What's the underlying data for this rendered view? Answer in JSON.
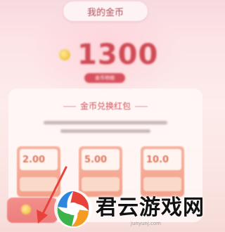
{
  "header": {
    "title": "我的金币"
  },
  "balance": {
    "amount": "1300",
    "detail_label": "金币明细"
  },
  "exchange": {
    "title": "金币兑换红包",
    "rewards": [
      {
        "amount": "2.00"
      },
      {
        "amount": "5.00"
      },
      {
        "amount": "10.0"
      }
    ]
  },
  "watermark": {
    "brand": "君云游戏网",
    "url": "junyunj.com"
  },
  "colors": {
    "accent": "#cf4b55",
    "coin": "#f2c94c",
    "reward_card": "#f3a28c",
    "arrow": "#e8433a"
  },
  "icons": {
    "coin": "coin-icon",
    "logo": "junyun-logo-icon"
  }
}
